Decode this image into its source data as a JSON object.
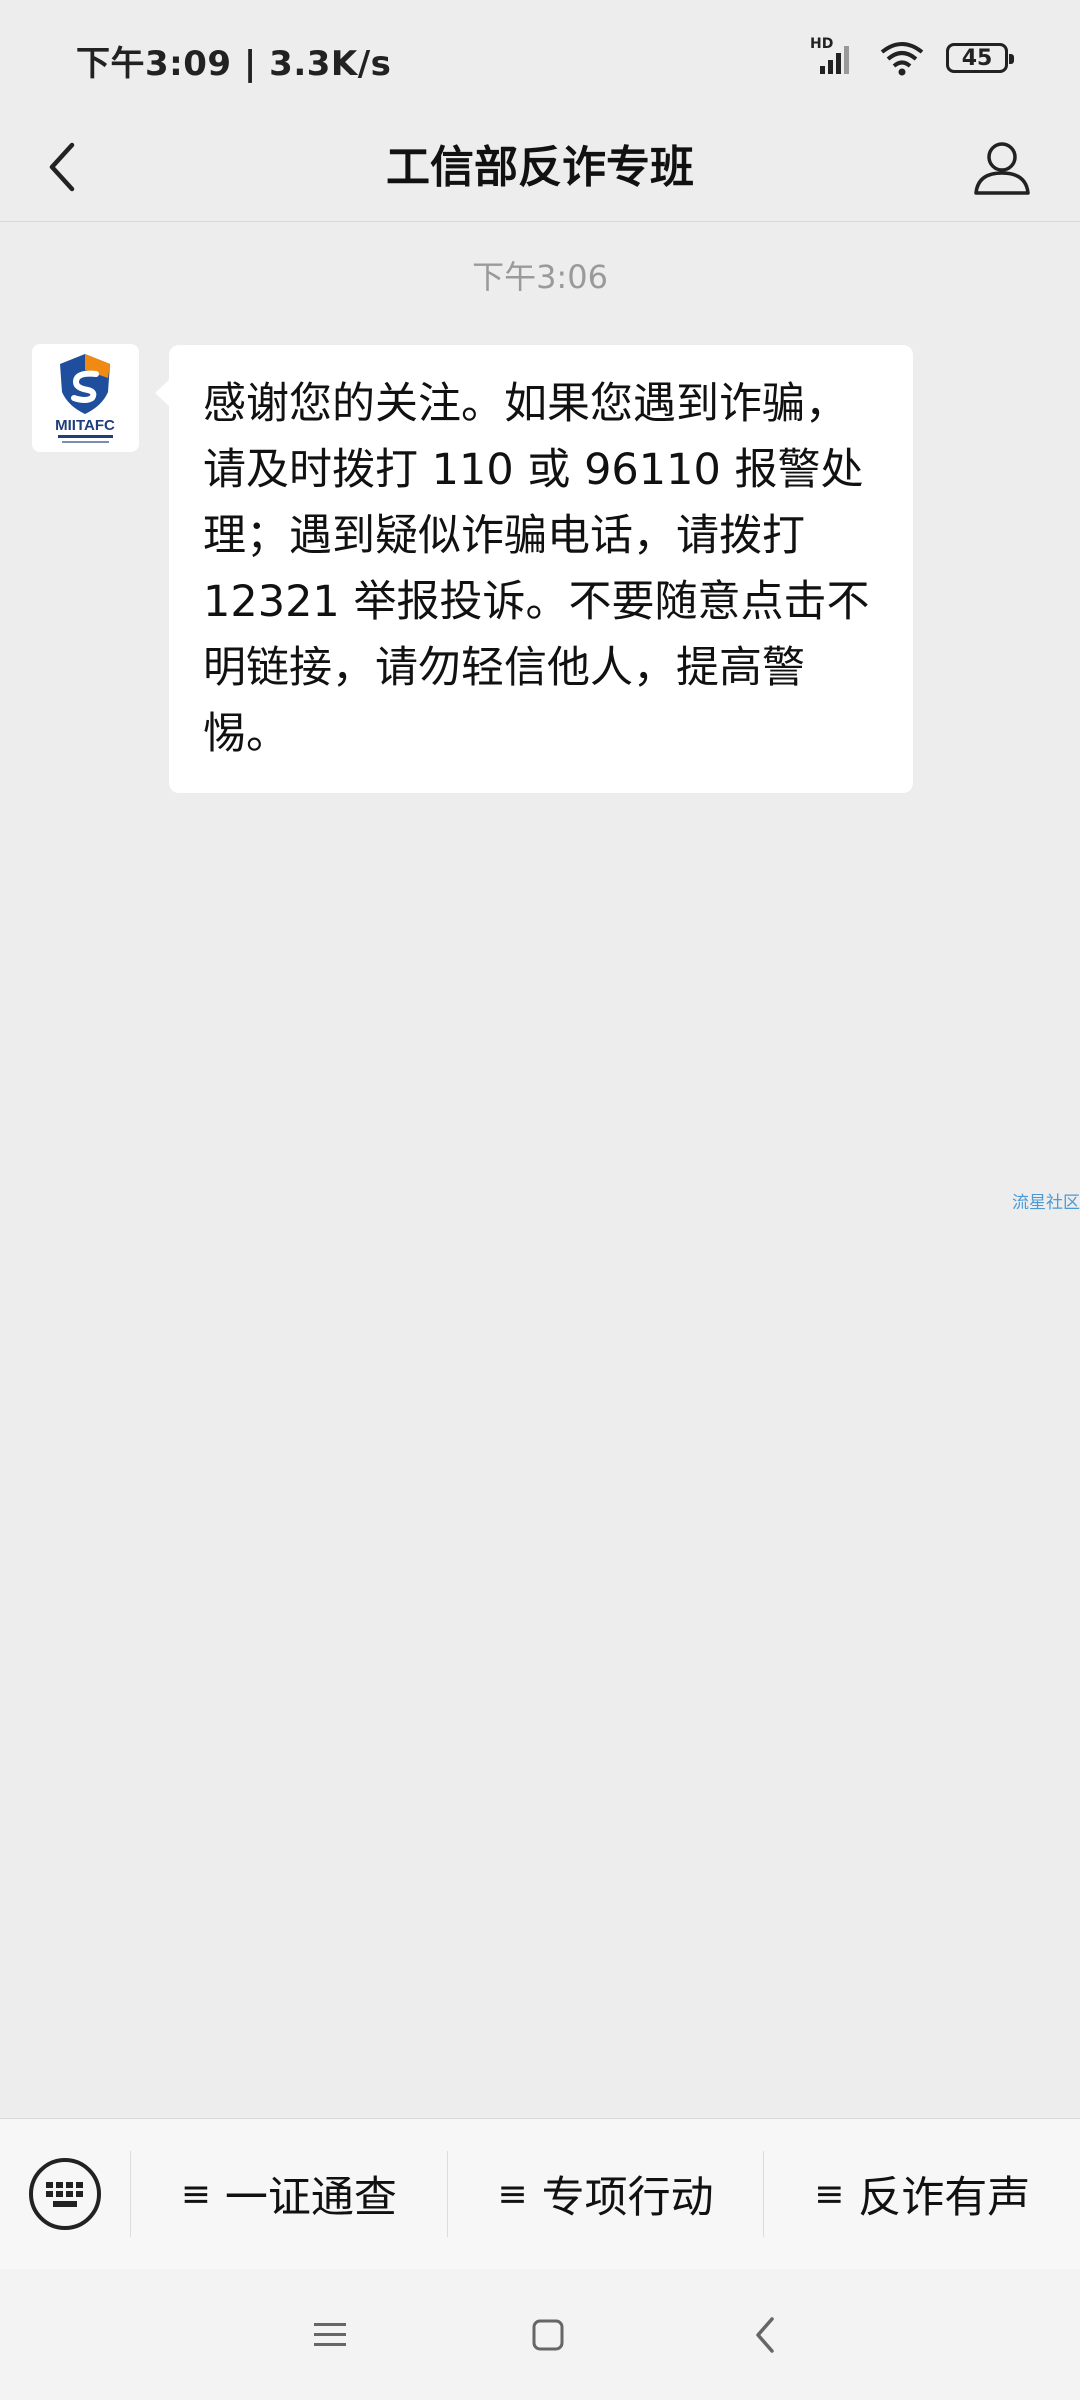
{
  "status": {
    "time": "下午3:09 | 3.3K/s",
    "signal_tag": "HD",
    "battery": "45"
  },
  "header": {
    "title": "工信部反诈专班"
  },
  "chat": {
    "timestamp": "下午3:06",
    "avatar_text": "MIITAFC",
    "message": "感谢您的关注。如果您遇到诈骗，请及时拨打 110 或 96110 报警处理；遇到疑似诈骗电话，请拨打 12321 举报投诉。不要随意点击不明链接，请勿轻信他人，提高警惕。"
  },
  "watermark": "流星社区",
  "menu": {
    "items": [
      {
        "glyph": "≡",
        "label": "一证通查"
      },
      {
        "glyph": "≡",
        "label": "专项行动"
      },
      {
        "glyph": "≡",
        "label": "反诈有声"
      }
    ]
  }
}
